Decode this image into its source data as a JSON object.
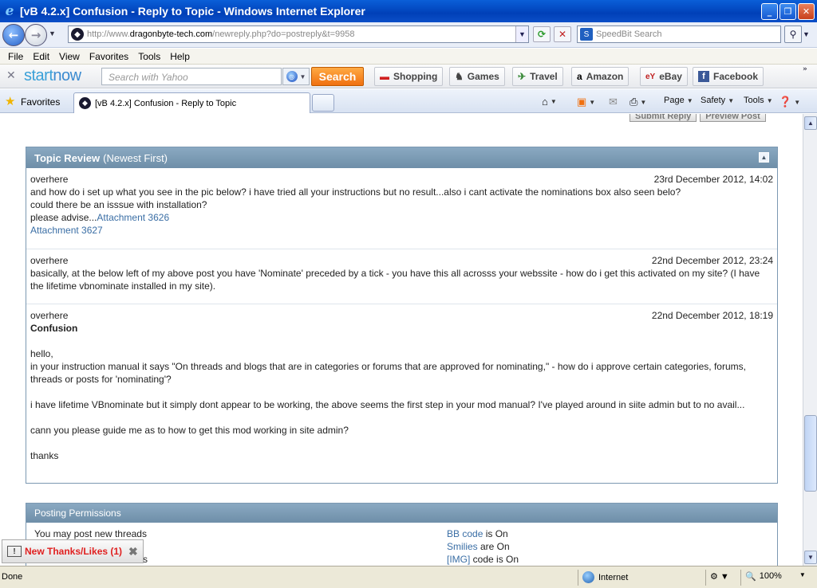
{
  "window": {
    "title": "[vB 4.2.x] Confusion - Reply to Topic - Windows Internet Explorer"
  },
  "address": {
    "prefix": "http://www.",
    "domain": "dragonbyte-tech.com",
    "path": "/newreply.php?do=postreply&t=9958"
  },
  "search_box": {
    "placeholder": "SpeedBit Search"
  },
  "menu": [
    "File",
    "Edit",
    "View",
    "Favorites",
    "Tools",
    "Help"
  ],
  "yahoo_bar": {
    "logo_a": "start",
    "logo_b": "now",
    "search_placeholder": "Search with Yahoo",
    "search_button": "Search",
    "links": [
      "Shopping",
      "Games",
      "Travel",
      "Amazon",
      "eBay",
      "Facebook"
    ]
  },
  "favorites_bar": {
    "favorites_label": "Favorites",
    "tab_title": "[vB 4.2.x] Confusion - Reply to Topic",
    "commands": [
      "Page",
      "Safety",
      "Tools"
    ]
  },
  "top_buttons": [
    "Submit Reply",
    "Preview Post"
  ],
  "topic_review": {
    "title": "Topic Review",
    "subtitle": "(Newest First)",
    "posts": [
      {
        "author": "overhere",
        "date": "23rd December 2012, 14:02",
        "line1": "and how do i set up what you see in the pic below? i have tried all your instructions but no result...also i cant activate the nominations box also seen belo?",
        "line2": "could there be an isssue with installation?",
        "line3": "please advise...",
        "attach1": "Attachment 3626",
        "attach2": "Attachment 3627"
      },
      {
        "author": "overhere",
        "date": "22nd December 2012, 23:24",
        "body": "basically, at the below left of my above post you have 'Nominate' preceded by a tick - you have this all acrosss your webssite - how do i get this activated on my site? (I have the lifetime vbnominate installed in my site)."
      },
      {
        "author": "overhere",
        "date": "22nd December 2012, 18:19",
        "title": "Confusion",
        "p1": "hello,",
        "p2": "in your instruction manual it says \"On threads and blogs that are in categories or forums that are approved for nominating,\" - how do i approve certain categories, forums, threads or posts for 'nominating'?",
        "p3": "i have lifetime VBnominate but it simply dont appear to be working, the above seems the first step in your mod manual? I've played around in siite admin but to no avail...",
        "p4": "cann you please guide me as to how to get this mod working in site admin?",
        "p5": "thanks"
      }
    ]
  },
  "permissions": {
    "title": "Posting Permissions",
    "left": [
      "You may post new threads",
      "nts"
    ],
    "right": [
      {
        "link": "BB code",
        "text": " is On"
      },
      {
        "link": "Smilies",
        "text": " are On"
      },
      {
        "link": "[IMG]",
        "text": " code is On"
      }
    ]
  },
  "toast": {
    "label": "New Thanks/Likes (1)"
  },
  "status": {
    "left": "Done",
    "zone": "Internet",
    "zoom": "100%"
  }
}
